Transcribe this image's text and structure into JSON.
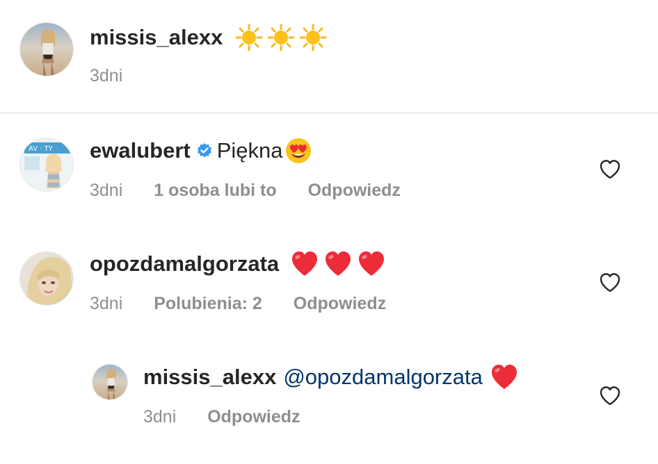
{
  "caption": {
    "username": "missis_alexx",
    "time": "3dni"
  },
  "comments": [
    {
      "username": "ewalubert",
      "verified": true,
      "text": "Piękna",
      "time": "3dni",
      "likes": "1 osoba lubi to",
      "reply": "Odpowiedz"
    },
    {
      "username": "opozdamalgorzata",
      "text": "",
      "time": "3dni",
      "likes": "Polubienia: 2",
      "reply": "Odpowiedz"
    },
    {
      "username": "missis_alexx",
      "mention": "@opozdamalgorzata",
      "time": "3dni",
      "reply": "Odpowiedz"
    }
  ],
  "icons": {
    "like": "heart-outline-icon",
    "verified": "verified-badge-icon",
    "sun": "sun-emoji",
    "heart": "red-heart-emoji",
    "heart_eyes": "heart-eyes-emoji"
  },
  "colors": {
    "text": "#262626",
    "secondary": "#8e8e8e",
    "mention": "#003569",
    "verified": "#3897f0",
    "heart": "#ed2c3a",
    "sun": "#f9b81c"
  }
}
